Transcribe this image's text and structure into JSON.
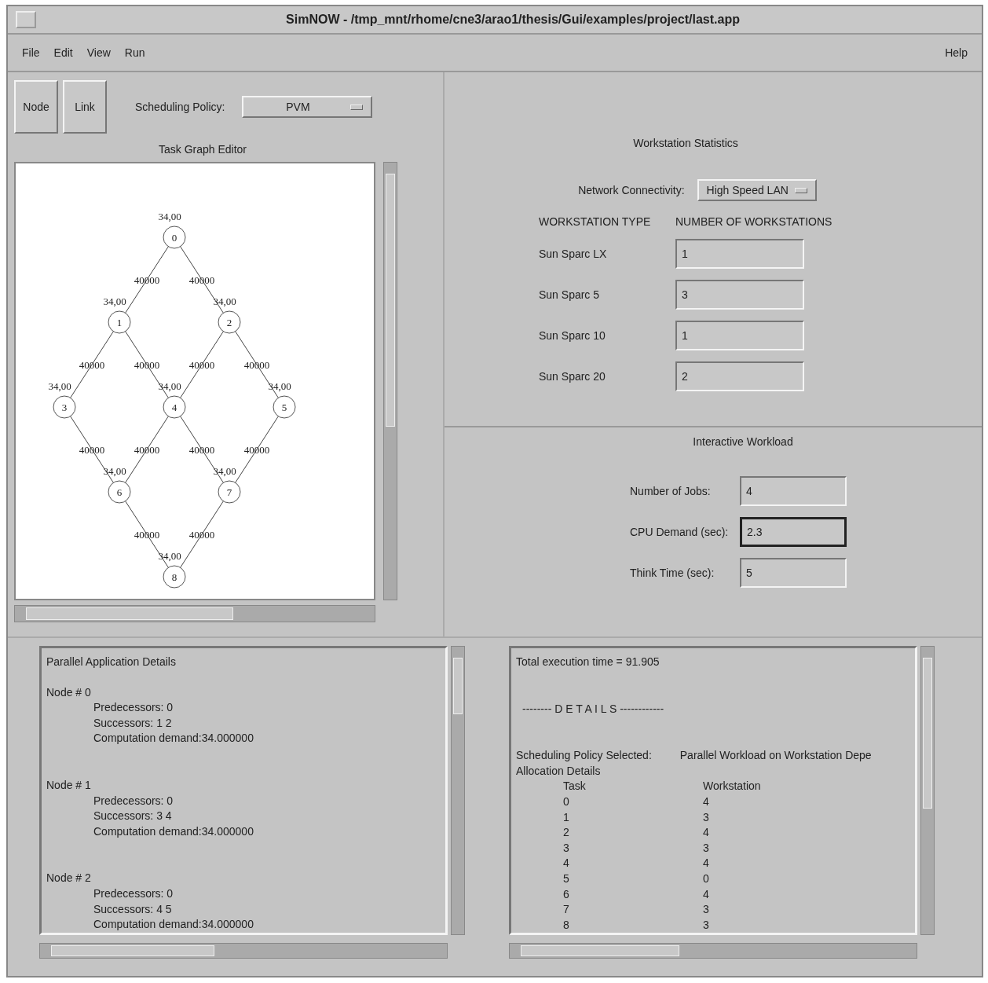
{
  "window": {
    "title": "SimNOW - /tmp_mnt/rhome/cne3/arao1/thesis/Gui/examples/project/last.app"
  },
  "menu": {
    "items": [
      "File",
      "Edit",
      "View",
      "Run"
    ],
    "help": "Help"
  },
  "toolbar": {
    "buttons": [
      "Node",
      "Link"
    ],
    "policy_label": "Scheduling Policy:",
    "policy_value": "PVM"
  },
  "task_graph": {
    "title": "Task Graph Editor",
    "levels": [
      [
        {
          "label": "0",
          "weight": "34,00",
          "edges": [
            {
              "kind": "left",
              "label": "40000"
            },
            {
              "kind": "right",
              "label": "40000"
            }
          ]
        }
      ],
      [
        {
          "label": "1",
          "weight": "34,00",
          "edges": [
            {
              "kind": "left",
              "label": "40000"
            },
            {
              "kind": "right",
              "label": "40000"
            }
          ]
        },
        {
          "label": "2",
          "weight": "34,00",
          "edges": [
            {
              "kind": "left",
              "label": "40000"
            },
            {
              "kind": "right",
              "label": "40000"
            }
          ]
        }
      ],
      [
        {
          "label": "3",
          "weight": "34,00",
          "edges": [
            {
              "kind": "right",
              "label": "40000"
            }
          ]
        },
        {
          "label": "4",
          "weight": "34,00",
          "edges": [
            {
              "kind": "left",
              "label": "40000"
            },
            {
              "kind": "right",
              "label": "40000"
            }
          ]
        },
        {
          "label": "5",
          "weight": "34,00",
          "edges": [
            {
              "kind": "left",
              "label": "40000"
            }
          ]
        }
      ],
      [
        {
          "label": "6",
          "weight": "34,00",
          "edges": [
            {
              "kind": "right",
              "label": "40000"
            }
          ]
        },
        {
          "label": "7",
          "weight": "34,00",
          "edges": [
            {
              "kind": "left",
              "label": "40000"
            }
          ]
        }
      ],
      [
        {
          "label": "8",
          "weight": "34,00"
        }
      ]
    ]
  },
  "workstation_statistics": {
    "title": "Workstation Statistics",
    "network_label": "Network Connectivity:",
    "network_value": "High Speed LAN",
    "column_1": "WORKSTATION TYPE",
    "column_2": "NUMBER OF WORKSTATIONS",
    "rows": [
      {
        "type": "Sun Sparc LX",
        "value": "1"
      },
      {
        "type": "Sun Sparc 5",
        "value": "3"
      },
      {
        "type": "Sun Sparc 10",
        "value": "1"
      },
      {
        "type": "Sun Sparc 20",
        "value": "2"
      }
    ]
  },
  "interactive_workload": {
    "title": "Interactive Workload",
    "fields": [
      {
        "label": "Number of Jobs:",
        "value": "4",
        "focused": false
      },
      {
        "label": "CPU Demand (sec):",
        "value": "2.3",
        "focused": true
      },
      {
        "label": "Think Time (sec):",
        "value": "5",
        "focused": false
      }
    ]
  },
  "application_details": {
    "title": "Parallel Application Details",
    "nodes": [
      {
        "title": "Node # 0",
        "lines": [
          "Predecessors: 0",
          "Successors: 1 2",
          "Computation demand:34.000000"
        ]
      },
      {
        "title": "Node # 1",
        "lines": [
          "Predecessors: 0",
          "Successors: 3 4",
          "Computation demand:34.000000"
        ]
      },
      {
        "title": "Node # 2",
        "lines": [
          "Predecessors: 0",
          "Successors: 4 5",
          "Computation demand:34.000000"
        ]
      }
    ]
  },
  "results": {
    "total": "Total execution time = 91.905",
    "details_heading": "-------- D E T A I L S ------------",
    "policy_label": "Scheduling Policy Selected:",
    "policy_value": "Parallel Workload on Workstation Depe",
    "allocation_title": "Allocation Details",
    "columns": [
      "Task",
      "Workstation"
    ],
    "rows": [
      [
        "0",
        "4"
      ],
      [
        "1",
        "3"
      ],
      [
        "2",
        "4"
      ],
      [
        "3",
        "3"
      ],
      [
        "4",
        "4"
      ],
      [
        "5",
        "0"
      ],
      [
        "6",
        "4"
      ],
      [
        "7",
        "3"
      ],
      [
        "8",
        "3"
      ]
    ]
  }
}
